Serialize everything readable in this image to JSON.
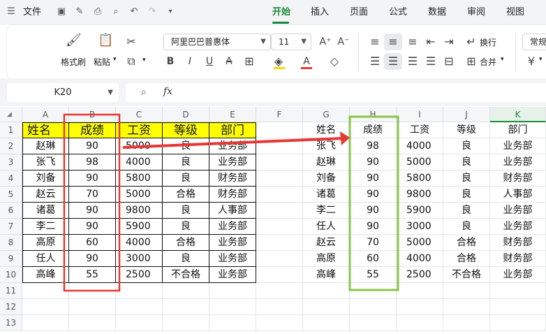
{
  "menubar": {
    "file_label": "文件",
    "tabs": [
      "开始",
      "插入",
      "页面",
      "公式",
      "数据",
      "审阅",
      "视图"
    ],
    "active_tab": "开始"
  },
  "ribbon": {
    "format_painter": "格式刷",
    "paste": "粘贴",
    "font_name": "阿里巴巴普惠体",
    "font_size": "11",
    "wrap": "换行",
    "merge": "合并",
    "number_format": "常规"
  },
  "formula_bar": {
    "name_box": "K20",
    "fx_label": "fx",
    "formula": ""
  },
  "sheet": {
    "columns": [
      "A",
      "B",
      "C",
      "D",
      "E",
      "F",
      "G",
      "H",
      "I",
      "J",
      "K"
    ],
    "selected_column": "K",
    "rows": [
      "1",
      "2",
      "3",
      "4",
      "5",
      "6",
      "7",
      "8",
      "9",
      "10",
      "11",
      "12",
      "13"
    ],
    "left_table": {
      "headers": [
        "姓名",
        "成绩",
        "工资",
        "等级",
        "部门"
      ],
      "rows": [
        [
          "赵琳",
          "90",
          "5000",
          "良",
          "业务部"
        ],
        [
          "张飞",
          "98",
          "4000",
          "良",
          "业务部"
        ],
        [
          "刘备",
          "90",
          "5800",
          "良",
          "财务部"
        ],
        [
          "赵云",
          "70",
          "5000",
          "合格",
          "财务部"
        ],
        [
          "诸葛",
          "90",
          "9800",
          "良",
          "人事部"
        ],
        [
          "李二",
          "90",
          "5900",
          "良",
          "业务部"
        ],
        [
          "高原",
          "60",
          "4000",
          "合格",
          "业务部"
        ],
        [
          "任人",
          "90",
          "3000",
          "良",
          "业务部"
        ],
        [
          "高峰",
          "55",
          "2500",
          "不合格",
          "业务部"
        ]
      ]
    },
    "right_table": {
      "headers": [
        "姓名",
        "成绩",
        "工资",
        "等级",
        "部门"
      ],
      "rows": [
        [
          "张飞",
          "98",
          "4000",
          "良",
          "业务部"
        ],
        [
          "赵琳",
          "90",
          "5000",
          "良",
          "业务部"
        ],
        [
          "刘备",
          "90",
          "5800",
          "良",
          "财务部"
        ],
        [
          "诸葛",
          "90",
          "9800",
          "良",
          "人事部"
        ],
        [
          "李二",
          "90",
          "5900",
          "良",
          "业务部"
        ],
        [
          "任人",
          "90",
          "3000",
          "良",
          "业务部"
        ],
        [
          "赵云",
          "70",
          "5000",
          "合格",
          "财务部"
        ],
        [
          "高原",
          "60",
          "4000",
          "合格",
          "财务部"
        ],
        [
          "高峰",
          "55",
          "2500",
          "不合格",
          "业务部"
        ]
      ]
    }
  },
  "colors": {
    "accent": "#1b8a3a",
    "header_fill": "#ffff00",
    "red_box": "#e53935",
    "green_box": "#8bc34a"
  }
}
